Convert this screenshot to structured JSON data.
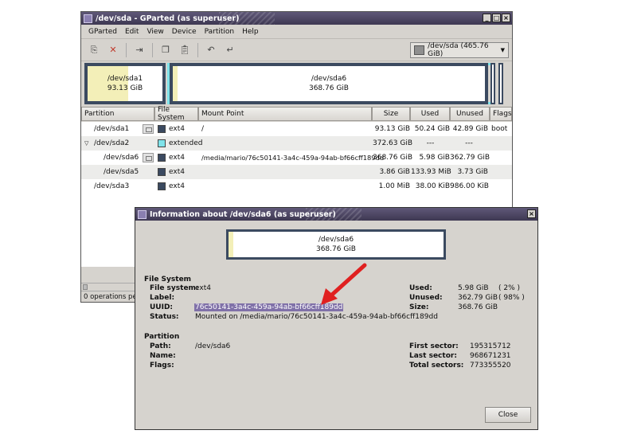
{
  "main_window": {
    "title": "/dev/sda - GParted (as superuser)",
    "menu": [
      "GParted",
      "Edit",
      "View",
      "Device",
      "Partition",
      "Help"
    ],
    "device_selector": "/dev/sda  (465.76 GiB)",
    "map": [
      {
        "name": "/dev/sda1",
        "size": "93.13 GiB"
      },
      {
        "name": "/dev/sda6",
        "size": "368.76 GiB"
      }
    ],
    "columns": [
      "Partition",
      "File System",
      "Mount Point",
      "Size",
      "Used",
      "Unused",
      "Flags"
    ],
    "rows": [
      {
        "partition": "/dev/sda1",
        "fs": "ext4",
        "fs_color": "#3b4a60",
        "mount": "/",
        "size": "93.13 GiB",
        "used": "50.24 GiB",
        "unused": "42.89 GiB",
        "flags": "boot"
      },
      {
        "partition": "/dev/sda2",
        "fs": "extended",
        "fs_color": "#7fe3ea",
        "mount": "",
        "size": "372.63 GiB",
        "used": "---",
        "unused": "---",
        "flags": ""
      },
      {
        "partition": "/dev/sda6",
        "fs": "ext4",
        "fs_color": "#3b4a60",
        "mount": "/media/mario/76c50141-3a4c-459a-94ab-bf66cff189dd",
        "size": "368.76 GiB",
        "used": "5.98 GiB",
        "unused": "362.79 GiB",
        "flags": ""
      },
      {
        "partition": "/dev/sda5",
        "fs": "ext4",
        "fs_color": "#3b4a60",
        "mount": "",
        "size": "3.86 GiB",
        "used": "133.93 MiB",
        "unused": "3.73 GiB",
        "flags": ""
      },
      {
        "partition": "/dev/sda3",
        "fs": "ext4",
        "fs_color": "#3b4a60",
        "mount": "",
        "size": "1.00 MiB",
        "used": "38.00 KiB",
        "unused": "986.00 KiB",
        "flags": ""
      }
    ],
    "status": "0 operations pen"
  },
  "dialog": {
    "title": "Information about /dev/sda6 (as superuser)",
    "part_name": "/dev/sda6",
    "part_size": "368.76 GiB",
    "fs_section": "File System",
    "fs_labels": [
      "File system:",
      "Label:",
      "UUID:",
      "Status:"
    ],
    "fs_values": [
      "ext4",
      "",
      "76c50141-3a4c-459a-94ab-bf66cff189dd",
      "Mounted on /media/mario/76c50141-3a4c-459a-94ab-bf66cff189dd"
    ],
    "usage_labels": [
      "Used:",
      "Unused:",
      "Size:"
    ],
    "usage_values": [
      "5.98 GiB",
      "362.79 GiB",
      "368.76 GiB"
    ],
    "usage_pct": [
      "( 2% )",
      "( 98% )",
      ""
    ],
    "part_section": "Partition",
    "part_labels": [
      "Path:",
      "Name:",
      "Flags:"
    ],
    "part_values": [
      "/dev/sda6",
      "",
      ""
    ],
    "sector_labels": [
      "First sector:",
      "Last sector:",
      "Total sectors:"
    ],
    "sector_values": [
      "195315712",
      "968671231",
      "773355520"
    ],
    "close_label": "Close"
  },
  "colors": {
    "ext4": "#3b4a60",
    "extended": "#7fe3ea",
    "used_fill": "#f3efb8",
    "annotation_arrow": "#e02020"
  }
}
